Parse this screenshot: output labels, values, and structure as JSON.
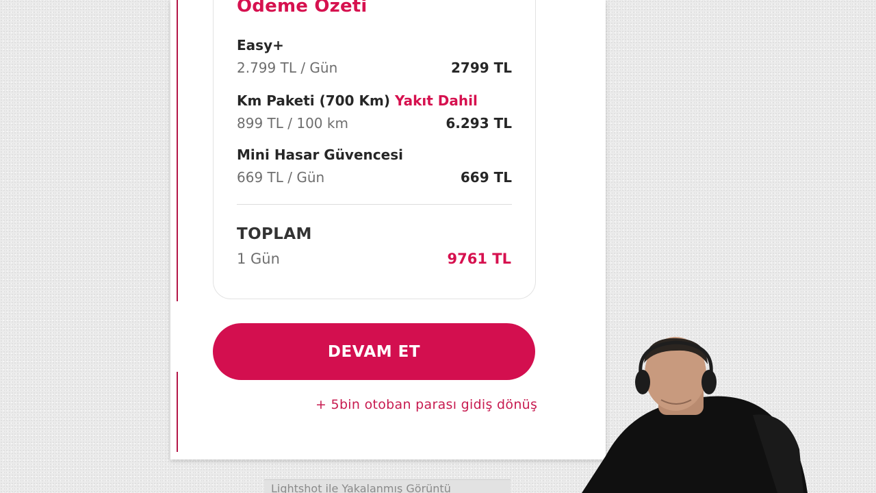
{
  "summary": {
    "title": "Ödeme Özeti",
    "items": [
      {
        "name": "Easy+",
        "highlight": "",
        "rate": "2.799 TL / Gün",
        "amount": "2799 TL"
      },
      {
        "name": "Km Paketi (700 Km)",
        "highlight": "Yakıt Dahil",
        "rate": "899 TL / 100 km",
        "amount": "6.293 TL"
      },
      {
        "name": "Mini Hasar Güvencesi",
        "highlight": "",
        "rate": "669 TL / Gün",
        "amount": "669 TL"
      }
    ],
    "total": {
      "label": "TOPLAM",
      "duration": "1 Gün",
      "amount": "9761 TL"
    }
  },
  "actions": {
    "continue_label": "DEVAM ET"
  },
  "annotation": {
    "note": "+ 5bin otoban parası gidiş dönüş"
  },
  "footer": {
    "caption": "Lightshot ile Yakalanmış Görüntü"
  },
  "colors": {
    "accent": "#d30f4f",
    "text_dark": "#262626",
    "text_muted": "#6e6e6e"
  }
}
